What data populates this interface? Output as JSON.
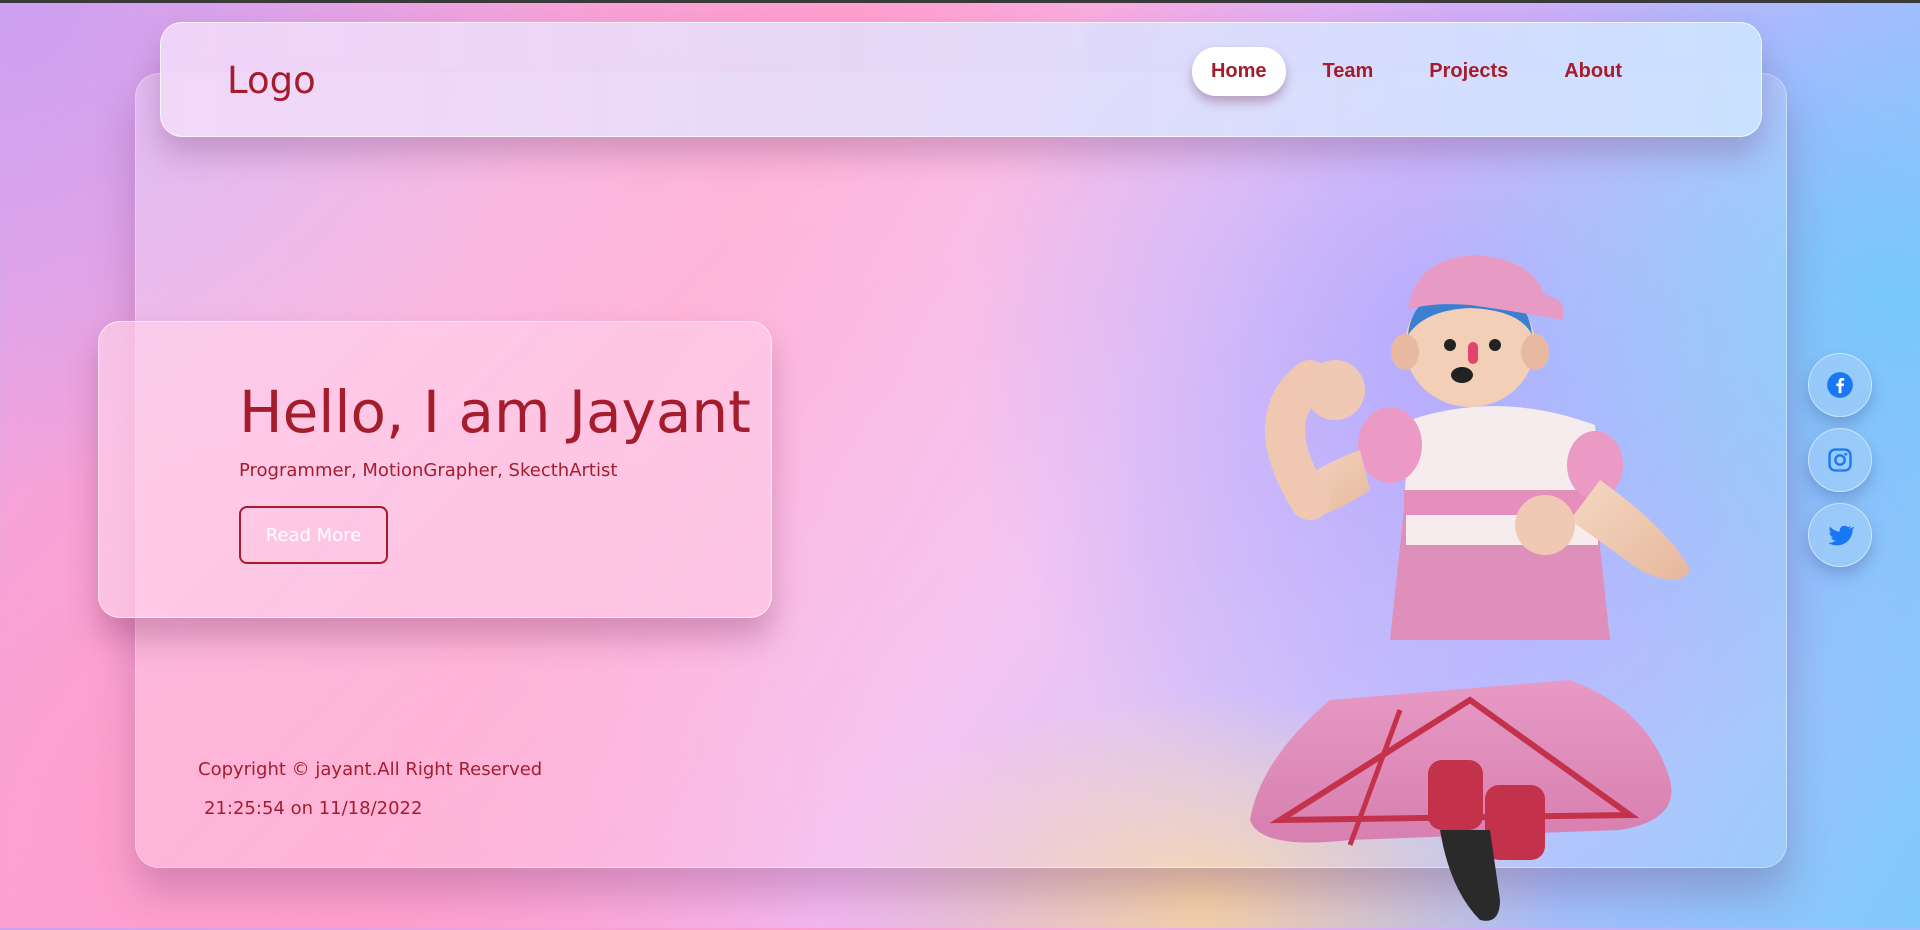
{
  "navbar": {
    "logo": "Logo",
    "links": [
      {
        "label": "Home",
        "active": true
      },
      {
        "label": "Team"
      },
      {
        "label": "Projects"
      },
      {
        "label": "About"
      }
    ]
  },
  "hero": {
    "title": "Hello, I am Jayant",
    "subtitle": "Programmer, MotionGrapher, SkecthArtist",
    "button_label": "Read More"
  },
  "footer": {
    "copyright": "Copyright © jayant.All Right Reserved",
    "timestamp": "21:25:54 on 11/18/2022"
  },
  "social": [
    {
      "icon": "facebook-icon"
    },
    {
      "icon": "instagram-icon"
    },
    {
      "icon": "twitter-icon"
    }
  ],
  "colors": {
    "accent": "#a51d2d",
    "social_icon": "#1877f2"
  }
}
